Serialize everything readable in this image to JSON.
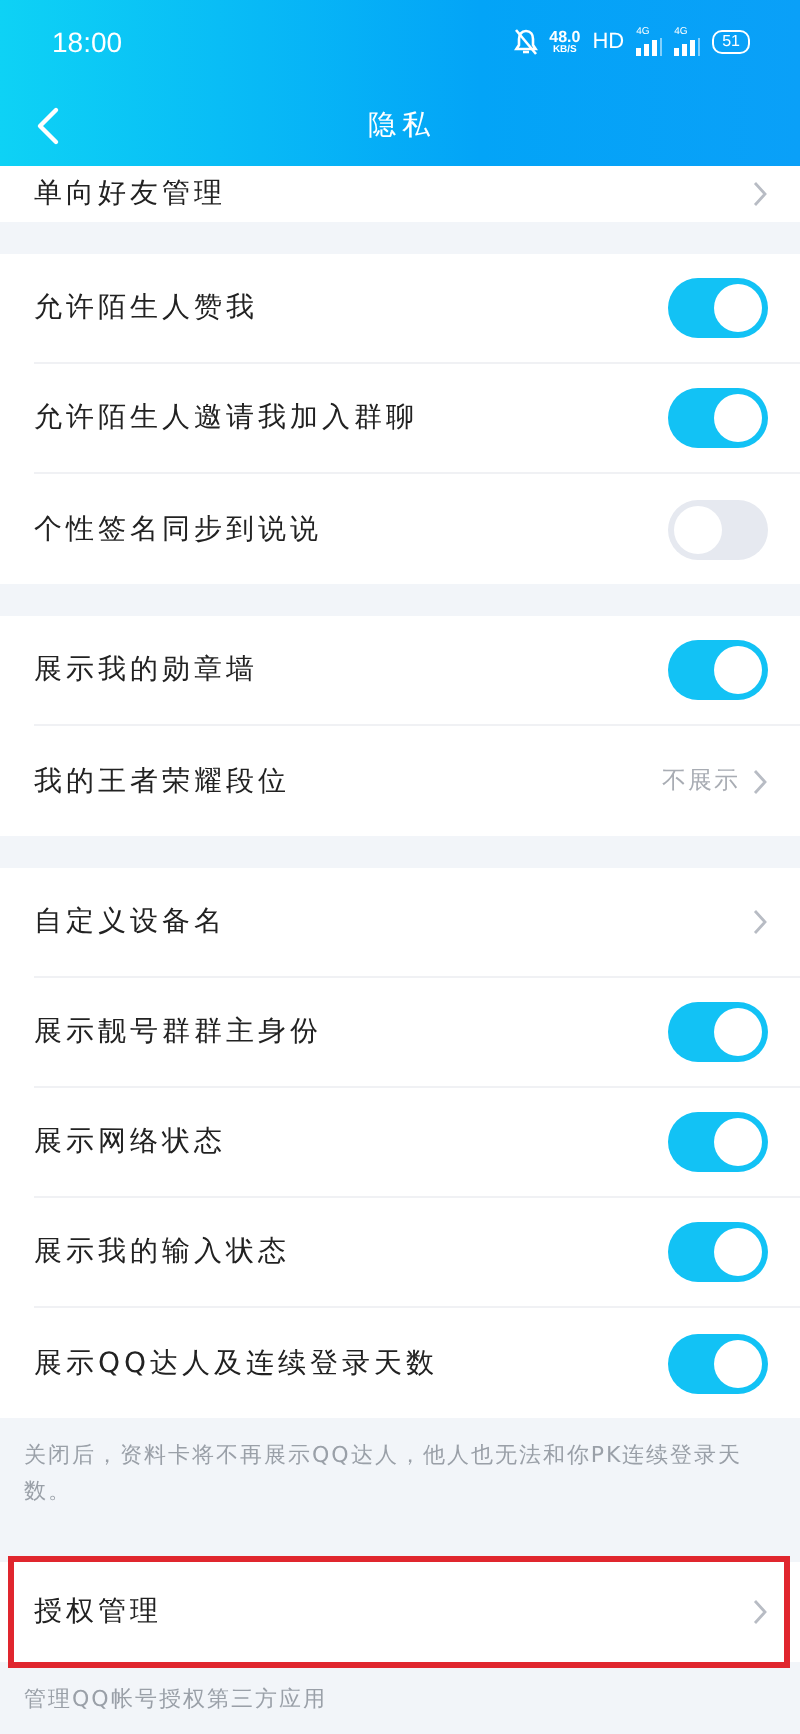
{
  "status_bar": {
    "time": "18:00",
    "speed": "48.0",
    "speed_unit": "KB/S",
    "hd": "HD",
    "network_1": "4G",
    "network_2": "4G",
    "battery": "51"
  },
  "nav": {
    "title": "隐私"
  },
  "sections": [
    {
      "rows": [
        {
          "kind": "link",
          "label": "单向好友管理",
          "highlighted": false
        }
      ]
    },
    {
      "rows": [
        {
          "kind": "toggle",
          "label": "允许陌生人赞我",
          "on": true
        },
        {
          "kind": "toggle",
          "label": "允许陌生人邀请我加入群聊",
          "on": true
        },
        {
          "kind": "toggle",
          "label": "个性签名同步到说说",
          "on": false
        }
      ]
    },
    {
      "rows": [
        {
          "kind": "toggle",
          "label": "展示我的勋章墙",
          "on": true
        },
        {
          "kind": "link",
          "label": "我的王者荣耀段位",
          "value": "不展示",
          "highlighted": false
        }
      ]
    },
    {
      "rows": [
        {
          "kind": "link",
          "label": "自定义设备名",
          "highlighted": false
        },
        {
          "kind": "toggle",
          "label": "展示靓号群群主身份",
          "on": true
        },
        {
          "kind": "toggle",
          "label": "展示网络状态",
          "on": true
        },
        {
          "kind": "toggle",
          "label": "展示我的输入状态",
          "on": true
        },
        {
          "kind": "toggle",
          "label": "展示QQ达人及连续登录天数",
          "on": true
        }
      ],
      "note": "关闭后，资料卡将不再展示QQ达人，他人也无法和你PK连续登录天数。"
    },
    {
      "rows": [
        {
          "kind": "link",
          "label": "授权管理",
          "highlighted": true
        }
      ],
      "note": "管理QQ帐号授权第三方应用"
    }
  ]
}
